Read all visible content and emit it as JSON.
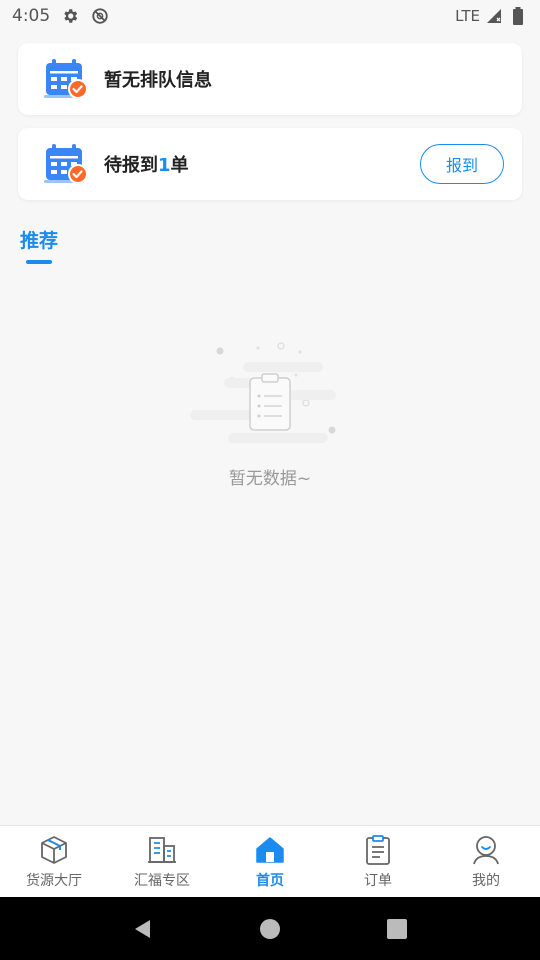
{
  "status_bar": {
    "time": "4:05",
    "network": "LTE"
  },
  "queue_card": {
    "text": "暂无排队信息"
  },
  "checkin_card": {
    "prefix": "待报到",
    "count": "1",
    "suffix": "单",
    "button_label": "报到"
  },
  "tabs": {
    "recommend_label": "推荐"
  },
  "empty_state": {
    "text": "暂无数据~"
  },
  "bottom_nav": {
    "items": [
      {
        "label": "货源大厅",
        "icon": "package-icon"
      },
      {
        "label": "汇福专区",
        "icon": "buildings-icon"
      },
      {
        "label": "首页",
        "icon": "home-icon"
      },
      {
        "label": "订单",
        "icon": "clipboard-icon"
      },
      {
        "label": "我的",
        "icon": "user-icon"
      }
    ],
    "active_index": 2
  },
  "colors": {
    "accent": "#1a8cf0",
    "badge": "#ff6a2b"
  }
}
